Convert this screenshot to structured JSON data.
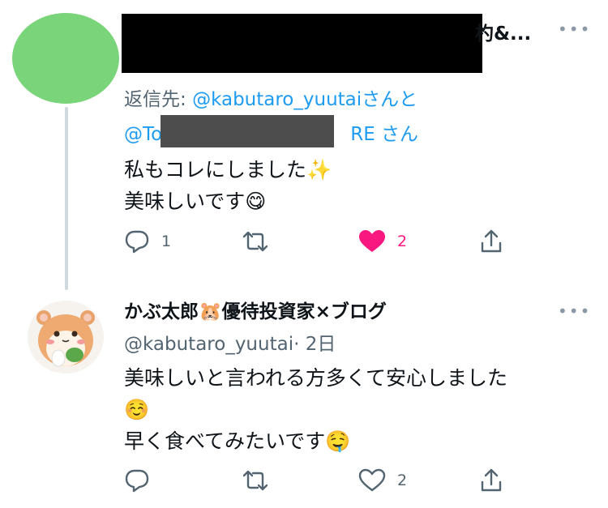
{
  "tweet1": {
    "display_name_tail": "杓&...",
    "reply_prefix": "返信先: ",
    "reply_handle1": "@kabutaro_yuutai",
    "reply_mid": "さんと",
    "reply_handle2_start": "@To",
    "reply_handle2_end": "RE",
    "reply_suffix": " さん",
    "text_line1": "私もコレにしました✨",
    "text_line2": "美味しいです😋",
    "reply_count": "1",
    "like_count": "2"
  },
  "tweet2": {
    "author": "かぶ太郎🐹優待投資家×ブログ",
    "handle": "@kabutaro_yuutai",
    "time": "· 2日",
    "text_line1": "美味しいと言われる方多くて安心しました",
    "text_line2": "☺️",
    "text_line3": "早く食べてみたいです🤤",
    "like_count": "2"
  },
  "colors": {
    "avatar1": "#7ad57a",
    "link": "#1d9bf0",
    "like_active": "#f91880",
    "muted": "#536471"
  },
  "icons": [
    "reply-icon",
    "retweet-icon",
    "like-icon",
    "share-icon",
    "more-icon",
    "avatar-hamster"
  ]
}
